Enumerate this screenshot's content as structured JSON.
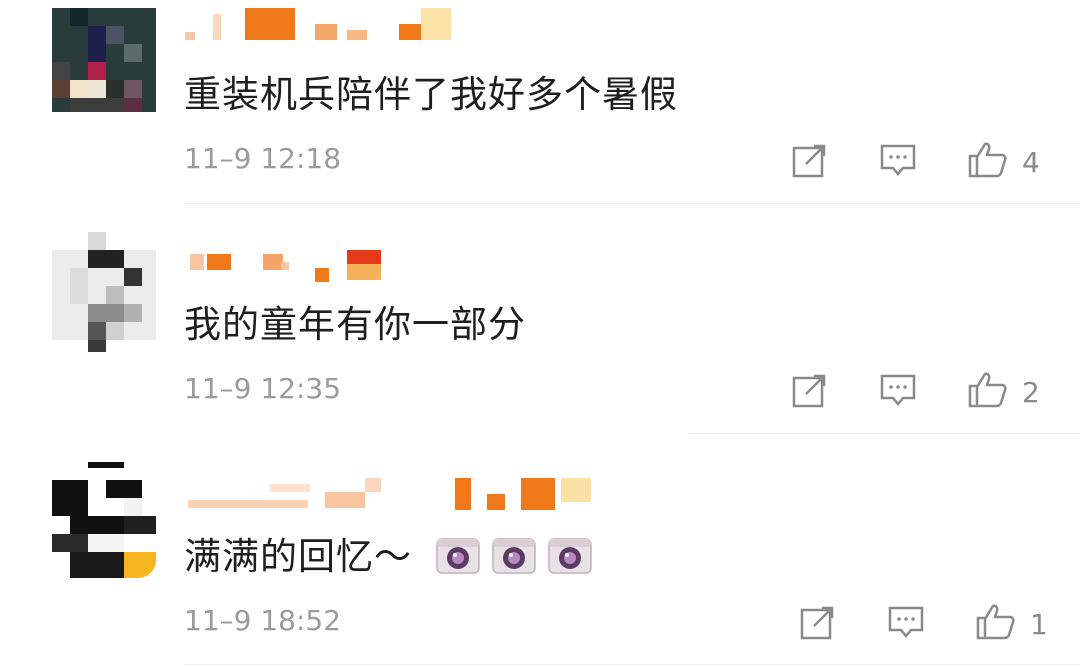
{
  "comments": [
    {
      "text": "重装机兵陪伴了我好多个暑假",
      "time": "11–9 12:18",
      "likes": "4",
      "emoji_count": 0
    },
    {
      "text": "我的童年有你一部分",
      "time": "11–9 12:35",
      "likes": "2",
      "emoji_count": 0
    },
    {
      "text": "满满的回忆～",
      "time": "11–9 18:52",
      "likes": "1",
      "emoji_count": 3
    }
  ],
  "icons": {
    "share": "share-icon",
    "comment": "comment-icon",
    "like": "thumbs-up-icon",
    "emoji": "camera-emoji-icon"
  },
  "colors": {
    "username_blocks": "#f07a1a",
    "time": "#9b9b9b",
    "icon": "#8a8a8a"
  }
}
